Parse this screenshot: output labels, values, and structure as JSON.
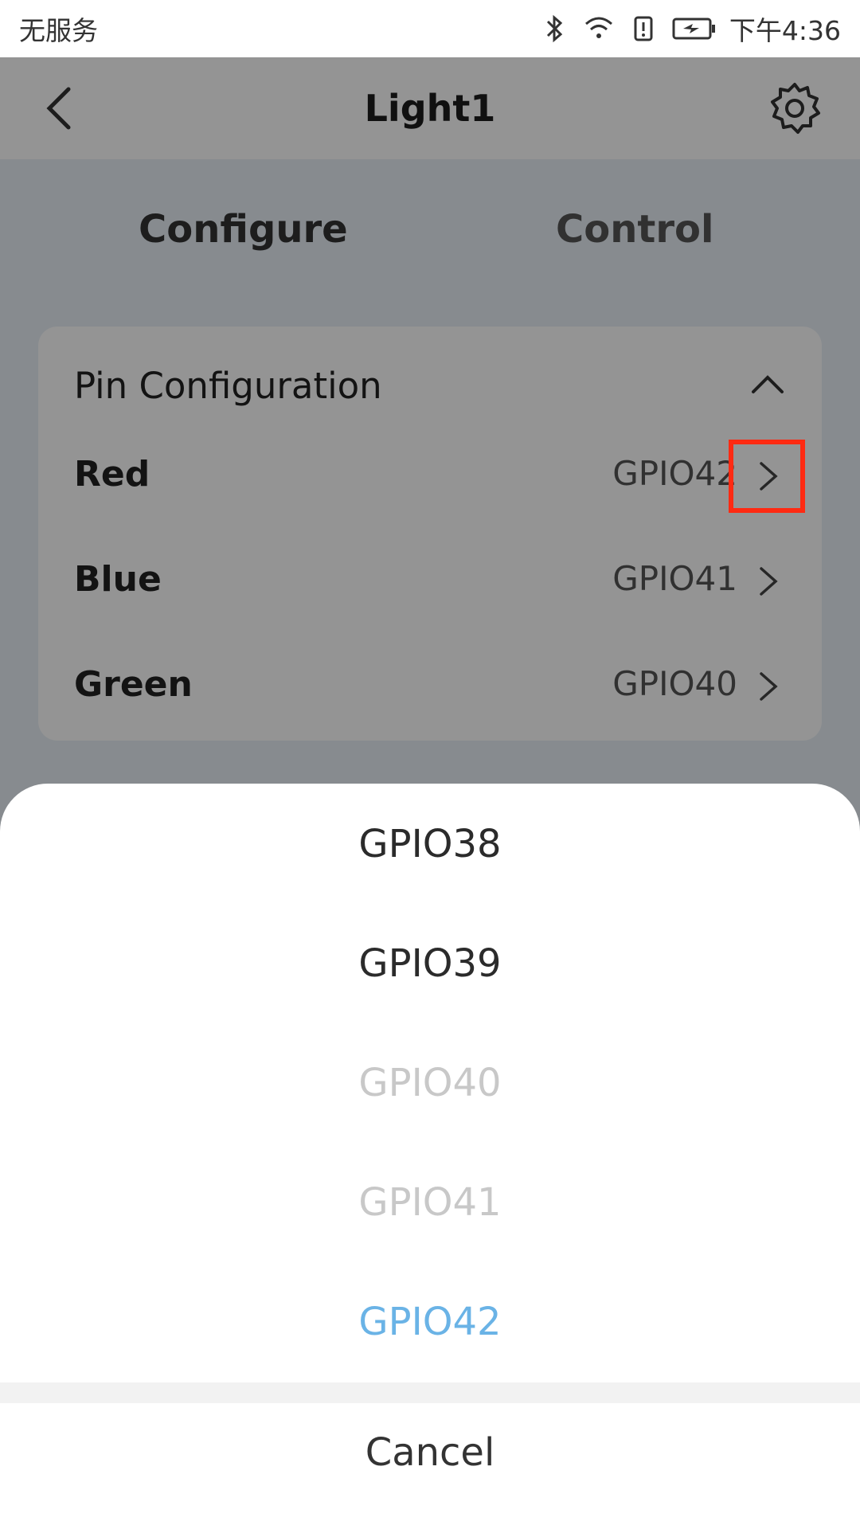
{
  "status_bar": {
    "carrier": "无服务",
    "time": "下午4:36",
    "icons": [
      "bluetooth-icon",
      "wifi-icon",
      "alert-icon",
      "battery-icon"
    ]
  },
  "app_bar": {
    "title": "Light1",
    "back_icon": "chevron-left-icon",
    "settings_icon": "gear-icon"
  },
  "tabs": [
    {
      "label": "Configure",
      "selected": true
    },
    {
      "label": "Control",
      "selected": false
    }
  ],
  "pin_configuration": {
    "header": "Pin Configuration",
    "collapse_icon": "chevron-up-icon",
    "rows": [
      {
        "label": "Red",
        "value": "GPIO42"
      },
      {
        "label": "Blue",
        "value": "GPIO41"
      },
      {
        "label": "Green",
        "value": "GPIO40"
      }
    ]
  },
  "picker": {
    "options": [
      "GPIO38",
      "GPIO39",
      "GPIO40",
      "GPIO41",
      "GPIO42"
    ],
    "cancel_label": "Cancel"
  },
  "colors": {
    "accent": "#3a84c4",
    "selected_option": "#6ab3e6",
    "disabled_option": "#c8c8c8",
    "highlight_box": "#ff2a12"
  }
}
